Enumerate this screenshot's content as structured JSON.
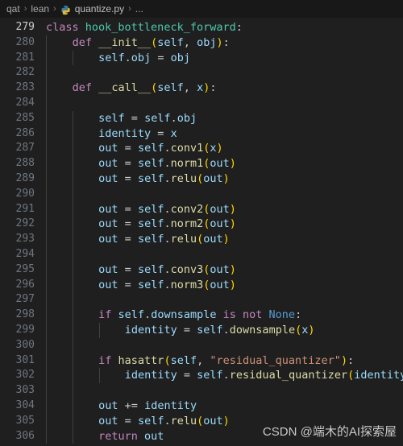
{
  "breadcrumb": {
    "items": [
      "qat",
      "lean",
      "quantize.py",
      "..."
    ],
    "separator": "›",
    "file_icon": "python-icon"
  },
  "editor": {
    "language": "python",
    "first_line_number": 279,
    "active_line_number": 279,
    "colors": {
      "background": "#1f1f1f",
      "gutter_text": "#6e7681",
      "active_gutter_text": "#cccccc",
      "keyword": "#c586c0",
      "class_name": "#4ec9b0",
      "function": "#dcdcaa",
      "variable": "#9cdcfe",
      "string": "#ce9178",
      "builtin": "#569cd6",
      "bracket": "#ffd700",
      "indent_guide": "#404040",
      "breadcrumb_bg": "#181818"
    },
    "lines": [
      {
        "n": "279",
        "text": "class hook_bottleneck_forward:"
      },
      {
        "n": "280",
        "text": "    def __init__(self, obj):"
      },
      {
        "n": "281",
        "text": "        self.obj = obj"
      },
      {
        "n": "282",
        "text": ""
      },
      {
        "n": "283",
        "text": "    def __call__(self, x):"
      },
      {
        "n": "284",
        "text": ""
      },
      {
        "n": "285",
        "text": "        self = self.obj"
      },
      {
        "n": "286",
        "text": "        identity = x"
      },
      {
        "n": "287",
        "text": "        out = self.conv1(x)"
      },
      {
        "n": "288",
        "text": "        out = self.norm1(out)"
      },
      {
        "n": "289",
        "text": "        out = self.relu(out)"
      },
      {
        "n": "290",
        "text": ""
      },
      {
        "n": "291",
        "text": "        out = self.conv2(out)"
      },
      {
        "n": "292",
        "text": "        out = self.norm2(out)"
      },
      {
        "n": "293",
        "text": "        out = self.relu(out)"
      },
      {
        "n": "294",
        "text": ""
      },
      {
        "n": "295",
        "text": "        out = self.conv3(out)"
      },
      {
        "n": "296",
        "text": "        out = self.norm3(out)"
      },
      {
        "n": "297",
        "text": ""
      },
      {
        "n": "298",
        "text": "        if self.downsample is not None:"
      },
      {
        "n": "299",
        "text": "            identity = self.downsample(x)"
      },
      {
        "n": "300",
        "text": ""
      },
      {
        "n": "301",
        "text": "        if hasattr(self, \"residual_quantizer\"):"
      },
      {
        "n": "302",
        "text": "            identity = self.residual_quantizer(identity)"
      },
      {
        "n": "303",
        "text": ""
      },
      {
        "n": "304",
        "text": "        out += identity"
      },
      {
        "n": "305",
        "text": "        out = self.relu(out)"
      },
      {
        "n": "306",
        "text": "        return out"
      }
    ]
  },
  "watermark": {
    "text": "CSDN @端木的AI探索屋"
  }
}
